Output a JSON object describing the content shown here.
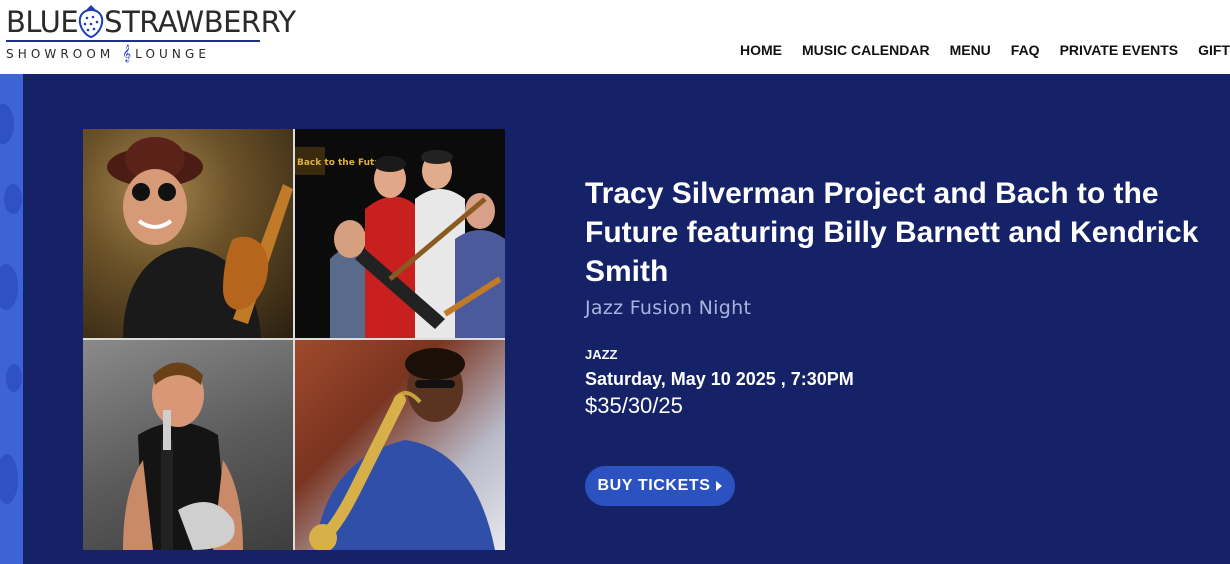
{
  "logo": {
    "word_left": "BLUE",
    "word_right": "STRAWBERRY",
    "tagline_left": "SHOWROOM",
    "tagline_clef": "𝄞",
    "tagline_right": "LOUNGE",
    "icon": "strawberry-icon"
  },
  "nav": {
    "items": [
      {
        "label": "HOME"
      },
      {
        "label": "MUSIC CALENDAR"
      },
      {
        "label": "MENU"
      },
      {
        "label": "FAQ"
      },
      {
        "label": "PRIVATE EVENTS"
      },
      {
        "label": "GIFT CAR"
      }
    ]
  },
  "event": {
    "title": "Tracy Silverman Project and Bach to the Future featuring Billy Barnett and Kendrick Smith",
    "subtitle": "Jazz Fusion Night",
    "genre": "JAZZ",
    "datetime": "Saturday, May 10 2025 , 7:30PM",
    "price": "$35/30/25",
    "buy_label": "BUY TICKETS",
    "photo_sign_text": "Back to the Future"
  },
  "colors": {
    "panel_bg": "#152268",
    "button_bg": "#2c52c2",
    "side_strip": "#3d63d6",
    "subtitle": "#a9b3dd"
  }
}
